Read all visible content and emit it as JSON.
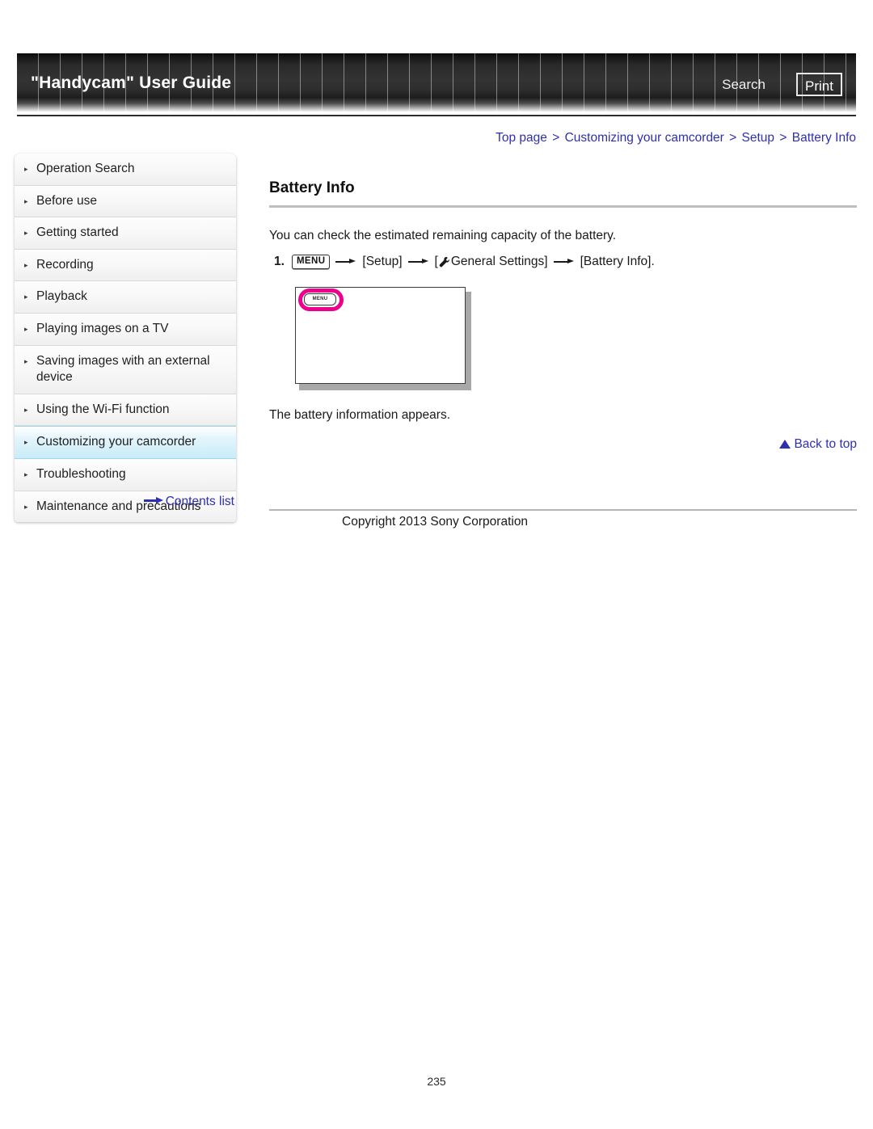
{
  "header": {
    "title": "\"Handycam\" User Guide",
    "search_label": "Search",
    "print_label": "Print"
  },
  "breadcrumb": {
    "items": [
      "Top page",
      "Customizing your camcorder",
      "Setup",
      "Battery Info"
    ],
    "separator": ">",
    "full_text": "Top page > Customizing your camcorder > Setup > Battery Info"
  },
  "sidebar": {
    "items": [
      {
        "label": "Operation Search",
        "active": false
      },
      {
        "label": "Before use",
        "active": false
      },
      {
        "label": "Getting started",
        "active": false
      },
      {
        "label": "Recording",
        "active": false
      },
      {
        "label": "Playback",
        "active": false
      },
      {
        "label": "Playing images on a TV",
        "active": false
      },
      {
        "label": "Saving images with an external device",
        "active": false
      },
      {
        "label": "Using the Wi-Fi function",
        "active": false
      },
      {
        "label": "Customizing your camcorder",
        "active": true
      },
      {
        "label": "Troubleshooting",
        "active": false
      },
      {
        "label": "Maintenance and precautions",
        "active": false
      }
    ],
    "bullet_glyph": "▸",
    "contents_list_label": "Contents list"
  },
  "main": {
    "page_title": "Battery Info",
    "intro_text": "You can check the estimated remaining capacity of the battery.",
    "step": {
      "number": "1.",
      "menu_chip": "MENU",
      "setup_label": "[Setup]",
      "general_settings_open": "[",
      "general_settings_label": "General Settings]",
      "battery_info_label": "[Battery Info]."
    },
    "figure": {
      "screen_menu_label": "MENU",
      "highlight_color": "#ec008c"
    },
    "result_text": "The battery information appears.",
    "back_to_top_label": "Back to top"
  },
  "footer": {
    "copyright": "Copyright 2013 Sony Corporation",
    "page_number": "235"
  },
  "colors": {
    "link": "#2f2fb0",
    "header_bg": "#2e2e2e",
    "active_nav": "#c9ecf7",
    "highlight": "#ec008c"
  }
}
